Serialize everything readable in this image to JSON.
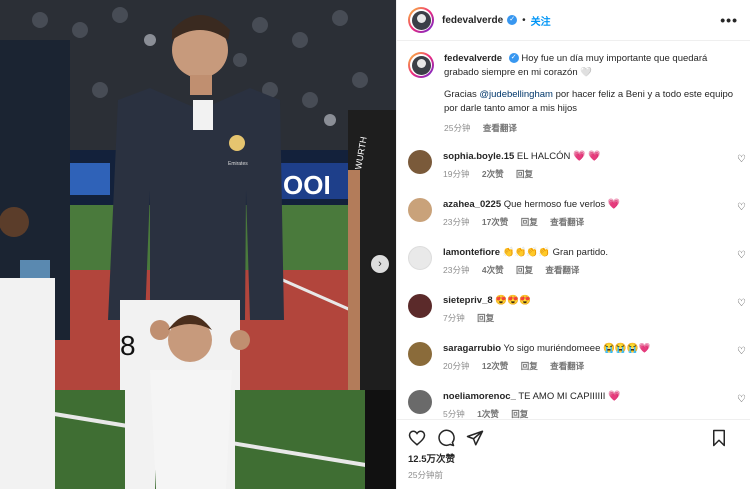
{
  "post": {
    "username": "fedevalverde",
    "verified_badge": "✓",
    "follow_label": "关注",
    "more_label": "•••",
    "caption_line1": "Hoy fue un día muy importante que quedará grabado siempre en mi corazón",
    "caption_emoji": "🤍",
    "caption_line2_prefix": "Gracias",
    "caption_mention": "@judebellingham",
    "caption_line2_rest": "por hacer feliz a Beni y a todo este equipo por darle tanto amor a mis hijos",
    "caption_time": "25分钟",
    "see_translation": "查看翻译",
    "next_icon": "chevron-right-icon",
    "likes": "12.5万次赞",
    "post_time": "25分钟前"
  },
  "photo": {
    "jersey_number": "8",
    "board_text": "WURTH",
    "ad_text": "OOI",
    "crest_text": "Emirates",
    "colors": {
      "stadium": "#1d2430",
      "jacket": "#2a3140",
      "pitch": "#4a7a3c",
      "track": "#b2453c",
      "white_kit": "#f2f2f2"
    }
  },
  "comments": [
    {
      "username": "sophia.boyle.15",
      "text": "EL HALCÓN",
      "emoji": "💗 💗",
      "time": "19分钟",
      "likes": "2次赞",
      "reply": "回复",
      "translate": "",
      "avatar_color": "#7a5a3a"
    },
    {
      "username": "azahea_0225",
      "text": "Que hermoso fue verlos",
      "emoji": "💗",
      "time": "23分钟",
      "likes": "17次赞",
      "reply": "回复",
      "translate": "查看翻译",
      "avatar_color": "#c9a27a"
    },
    {
      "username": "lamontefiore",
      "text": "Gran partido.",
      "emoji": "👏👏👏👏",
      "time": "23分钟",
      "likes": "4次赞",
      "reply": "回复",
      "translate": "查看翻译",
      "avatar_color": "#e9e9e9"
    },
    {
      "username": "sietepriv_8",
      "text": "",
      "emoji": "😍😍😍",
      "time": "7分钟",
      "likes": "",
      "reply": "回复",
      "translate": "",
      "avatar_color": "#5b2a2a"
    },
    {
      "username": "saragarrubio",
      "text": "Yo sigo muriéndomeee",
      "emoji": "😭😭😭💗",
      "time": "20分钟",
      "likes": "12次赞",
      "reply": "回复",
      "translate": "查看翻译",
      "avatar_color": "#8a6b3a"
    },
    {
      "username": "noeliamorenoc_",
      "text": "TE AMO MI CAPIIIIII",
      "emoji": "💗",
      "time": "5分钟",
      "likes": "1次赞",
      "reply": "回复",
      "translate": "",
      "avatar_color": "#6a6a6a"
    }
  ],
  "icons": {
    "like": "heart-icon",
    "comment": "comment-icon",
    "share": "share-icon",
    "save": "bookmark-icon"
  }
}
